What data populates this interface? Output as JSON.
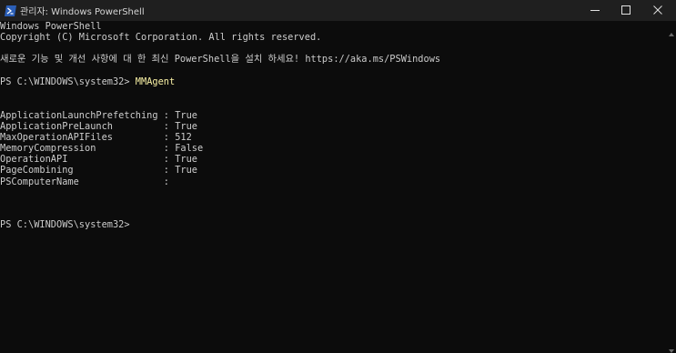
{
  "window": {
    "title": "관리자: Windows PowerShell",
    "icons": {
      "app": "powershell-icon",
      "minimize": "minimize-icon",
      "maximize": "maximize-icon",
      "close": "close-icon"
    }
  },
  "terminal": {
    "header_line_1": "Windows PowerShell",
    "header_line_2": "Copyright (C) Microsoft Corporation. All rights reserved.",
    "notice": "새로운 기능 및 개선 사항에 대 한 최신 PowerShell을 설치 하세요! https://aka.ms/PSWindows",
    "prompt_1": "PS C:\\WINDOWS\\system32> ",
    "command": "MMAgent",
    "properties": [
      {
        "name": "ApplicationLaunchPrefetching",
        "value": "True"
      },
      {
        "name": "ApplicationPreLaunch",
        "value": "True"
      },
      {
        "name": "MaxOperationAPIFiles",
        "value": "512"
      },
      {
        "name": "MemoryCompression",
        "value": "False"
      },
      {
        "name": "OperationAPI",
        "value": "True"
      },
      {
        "name": "PageCombining",
        "value": "True"
      },
      {
        "name": "PSComputerName",
        "value": ""
      }
    ],
    "prompt_2": "PS C:\\WINDOWS\\system32>"
  }
}
